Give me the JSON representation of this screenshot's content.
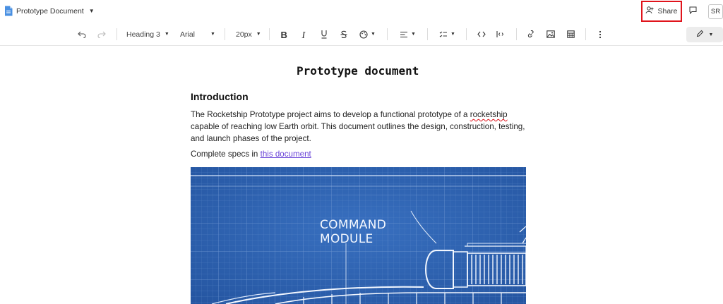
{
  "header": {
    "doc_title": "Prototype Document",
    "share_label": "Share",
    "avatar_initials": "SR"
  },
  "toolbar": {
    "block_style": "Heading 3",
    "font_family": "Arial",
    "font_size": "20px"
  },
  "document": {
    "title": "Prototype document",
    "section_heading": "Introduction",
    "intro_before": "The Rocketship Prototype project aims to develop a functional prototype of a ",
    "intro_misspelled": "rocketship",
    "intro_after": " capable of reaching low Earth orbit. This document outlines the design, construction, testing, and launch phases of the project.",
    "specs_prefix": "Complete specs in ",
    "specs_link": "this document"
  },
  "blueprint": {
    "label_line1": "COMMAND",
    "label_line2": "MODULE"
  },
  "colors": {
    "highlight": "#e0141c",
    "link": "#6a44d8",
    "blueprint_bg": "#2f64b4"
  }
}
